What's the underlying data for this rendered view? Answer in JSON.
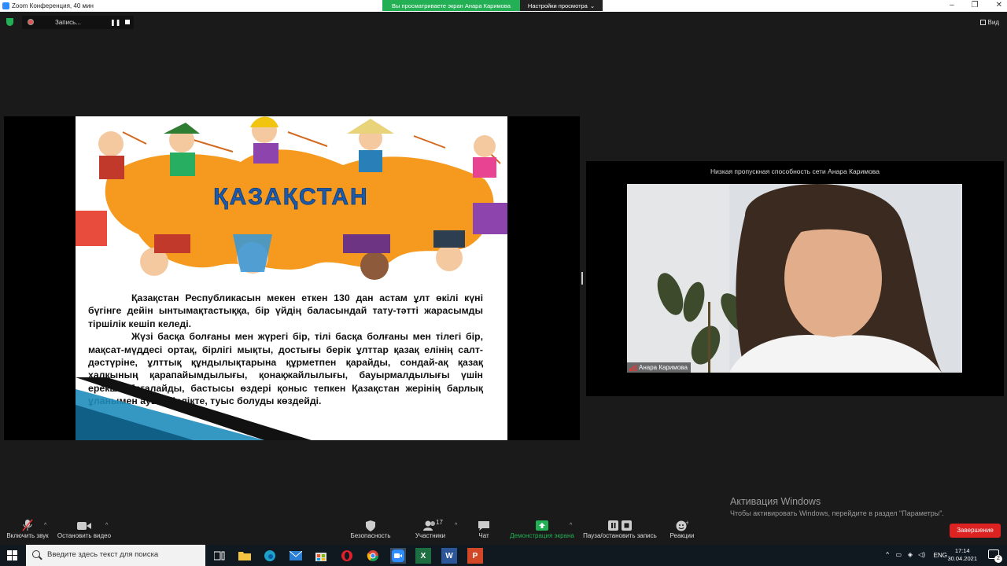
{
  "window": {
    "title": "Zoom Конференция, 40 мин"
  },
  "share_banner": {
    "message": "Вы просматриваете экран Анара Каримова",
    "view_options": "Настройки просмотра"
  },
  "recording": {
    "label": "Запись..."
  },
  "view": {
    "label": "Вид"
  },
  "slide": {
    "heading": "ҚАЗАҚСТАН",
    "paragraph1": "Қазақстан Республикасын мекен еткен 130 дан астам ұлт өкілі күні бүгінге дейін ынтымақтастыққа, бір үйдің баласындай тату-тәтті жарасымды тіршілік кешіп келеді.",
    "paragraph2": "Жүзі басқа болғаны мен жүрегі бір, тілі басқа болғаны мен тілегі бір, мақсат-мүддесі ортақ, бірлігі мықты, достығы берік ұлттар қазақ елінің салт-дәстүріне, ұлттық құндылықтарына құрметпен қарайды, сондай-ақ қазақ халқының қарапайымдылығы, қонақжайлылығы, бауырмалдылығы үшін ерекше бағалайды, бастысы өздері қоныс тепкен Қазақстан жерінің барлық ұланымен ауыз бірлікте, туыс болуды көздейді."
  },
  "video": {
    "notice": "Низкая пропускная способность сети Анара Каримова",
    "participant_name": "Анара Каримова"
  },
  "activation": {
    "title": "Активация Windows",
    "subtitle": "Чтобы активировать Windows, перейдите в раздел \"Параметры\"."
  },
  "toolbar": {
    "mic": "Включить звук",
    "video": "Остановить видео",
    "security": "Безопасность",
    "participants": "Участники",
    "participants_count": "17",
    "chat": "Чат",
    "share": "Демонстрация экрана",
    "record": "Пауза/остановить запись",
    "reactions": "Реакции",
    "end": "Завершение"
  },
  "taskbar": {
    "search_placeholder": "Введите здесь текст для поиска",
    "lang": "ENG",
    "time": "17:14",
    "date": "30.04.2021",
    "notifications": "2"
  },
  "colors": {
    "accent_green": "#23b055",
    "end_red": "#d22222",
    "zoom_blue": "#2d8cff"
  }
}
